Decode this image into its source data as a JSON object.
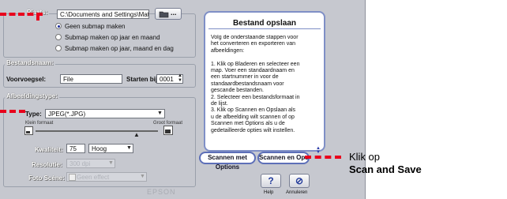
{
  "dialog": {
    "location": {
      "group_label": "Plaats:",
      "path_value": "C:\\Documents and Settings\\Matsu\\Mijn",
      "browse_label": "...",
      "options": [
        {
          "label": "Geen submap maken",
          "selected": true
        },
        {
          "label": "Submap maken op jaar en maand",
          "selected": false
        },
        {
          "label": "Submap maken op jaar, maand en dag",
          "selected": false
        }
      ]
    },
    "filename": {
      "group_label": "Bestandsnaam:",
      "prefix_label": "Voorvoegsel:",
      "prefix_value": "File",
      "start_label": "Starten bij:",
      "start_value": "0001"
    },
    "imagetype": {
      "group_label": "Afbeeldingstype:",
      "type_label": "Type:",
      "type_value": "JPEG(*.JPG)",
      "small_label": "Klein formaat",
      "large_label": "Groot formaat",
      "quality_label": "Kwaliteit:",
      "quality_value": "75",
      "quality_level": "Hoog",
      "resolution_label": "Resolutie:",
      "resolution_value": "300 dpi",
      "photoscene_label": "Foto Scène:",
      "photoscene_value": "Geen effect"
    },
    "help": {
      "title": "Bestand opslaan",
      "body": "Volg de onderstaande stappen voor\nhet converteren en exporteren van\nafbeeldingen:\n\n1. Klik op Bladeren en selecteer een\nmap. Voer een standaardnaam en\neen startnummer in voor de\nstandaardbestandsnaam voor\ngescande bestanden.\n2. Selecteer een bestandsformaat in\nde lijst.\n3. Klik op Scannen en Opslaan als\nu de afbeelding wilt scannen of op\nScannen met Options als u de\ngedetailleerde opties wilt instellen."
    },
    "buttons": {
      "scan_options": "Scannen met Options",
      "scan_save": "Scannen en Opslaan",
      "help_label": "Help",
      "cancel_label": "Annuleren",
      "help_glyph": "?",
      "cancel_glyph": "⊘"
    },
    "brand": "EPSON"
  },
  "callout": {
    "line1": "Klik op",
    "line2": "Scan and Save"
  },
  "colors": {
    "callout_red": "#e8001c",
    "dialog_bg": "#c6c8cf",
    "accent_blue": "#5d6fb8"
  }
}
